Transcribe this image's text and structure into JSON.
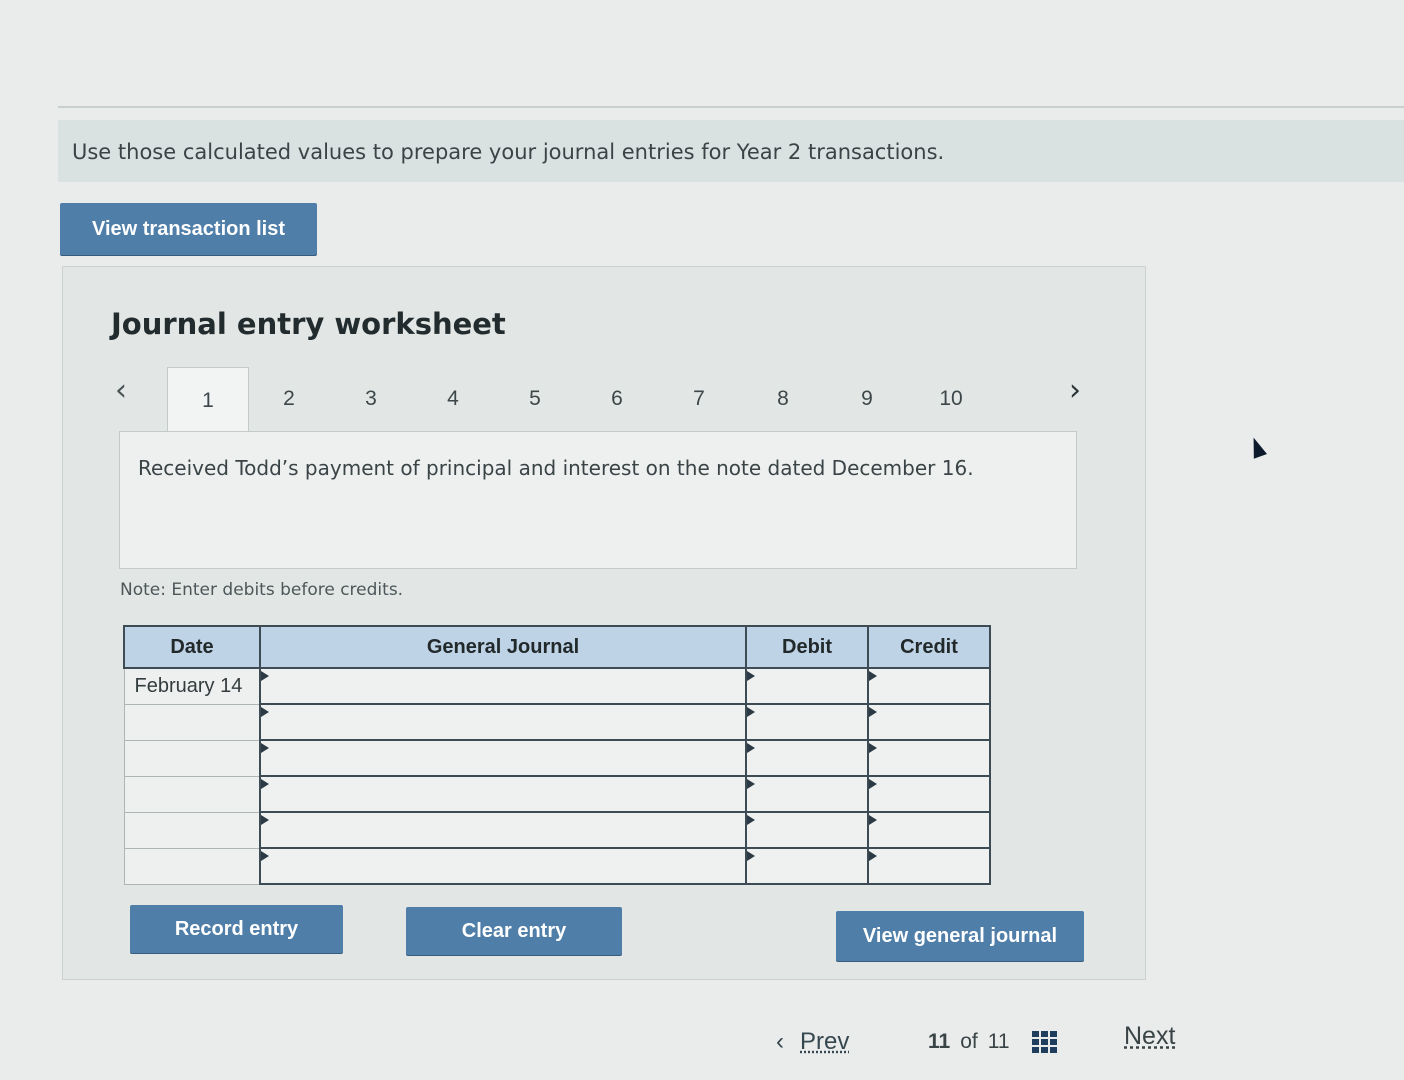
{
  "instruction": "Use those calculated values to prepare your journal entries for Year 2 transactions.",
  "buttons": {
    "view_transaction_list": "View transaction list",
    "record_entry": "Record entry",
    "clear_entry": "Clear entry",
    "view_general_journal": "View general journal"
  },
  "worksheet": {
    "title": "Journal entry worksheet",
    "tabs": [
      "1",
      "2",
      "3",
      "4",
      "5",
      "6",
      "7",
      "8",
      "9",
      "10"
    ],
    "active_tab": "1",
    "description": "Received Todd’s payment of principal and interest on the note dated December 16.",
    "note": "Note: Enter debits before credits."
  },
  "journal": {
    "headers": {
      "date": "Date",
      "general_journal": "General Journal",
      "debit": "Debit",
      "credit": "Credit"
    },
    "rows": [
      {
        "date": "February 14"
      },
      {
        "date": ""
      },
      {
        "date": ""
      },
      {
        "date": ""
      },
      {
        "date": ""
      },
      {
        "date": ""
      }
    ]
  },
  "footer": {
    "prev": "Prev",
    "current": "11",
    "of": "of",
    "total": "11",
    "next": "Next"
  }
}
